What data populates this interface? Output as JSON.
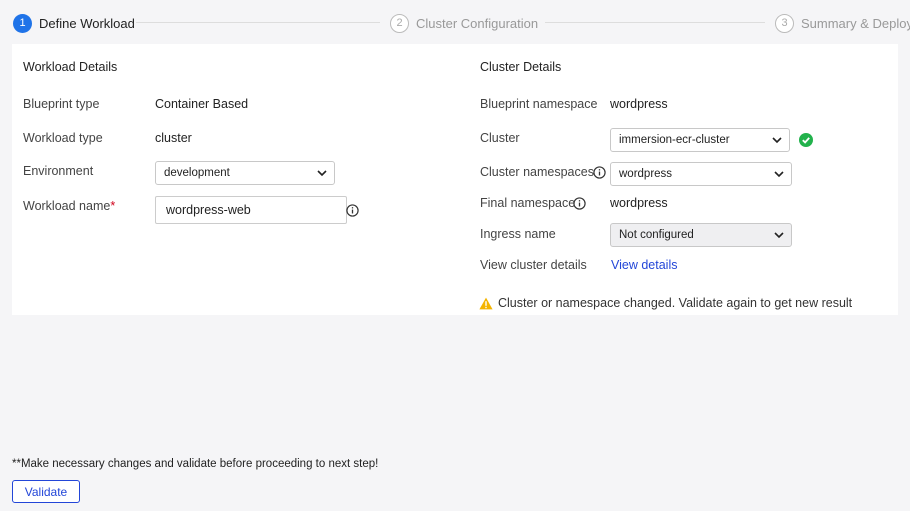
{
  "stepper": {
    "steps": [
      {
        "number": "1",
        "label": "Define Workload"
      },
      {
        "number": "2",
        "label": "Cluster Configuration"
      },
      {
        "number": "3",
        "label": "Summary & Deploy"
      }
    ]
  },
  "workload": {
    "title": "Workload Details",
    "blueprint_type_label": "Blueprint type",
    "blueprint_type_value": "Container Based",
    "workload_type_label": "Workload type",
    "workload_type_value": "cluster",
    "environment_label": "Environment",
    "environment_value": "development",
    "workload_name_label": "Workload name",
    "workload_name_required": "*",
    "workload_name_value": "wordpress-web"
  },
  "cluster": {
    "title": "Cluster Details",
    "blueprint_namespace_label": "Blueprint namespace",
    "blueprint_namespace_value": "wordpress",
    "cluster_label": "Cluster",
    "cluster_value": "immersion-ecr-cluster",
    "cluster_namespaces_label": "Cluster namespaces",
    "cluster_namespaces_value": "wordpress",
    "final_namespace_label": "Final namespace",
    "final_namespace_value": "wordpress",
    "ingress_label": "Ingress name",
    "ingress_value": "Not configured",
    "view_cluster_label": "View cluster details",
    "view_details_link": "View details",
    "warning_text": "Cluster or namespace changed. Validate again to get new result"
  },
  "footer": {
    "note": "**Make necessary changes and validate before proceeding to next step!",
    "validate_label": "Validate"
  },
  "colors": {
    "accent": "#1f73e8",
    "link": "#2346d8",
    "success": "#22b24c",
    "warning": "#f4b400",
    "required": "#d0021b"
  }
}
